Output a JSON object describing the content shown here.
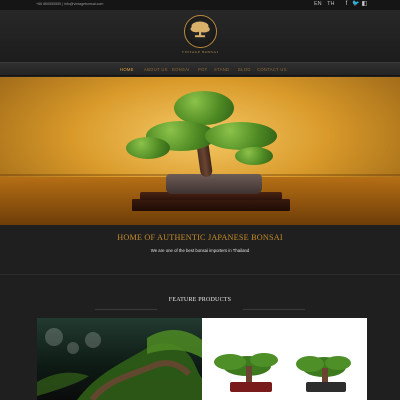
{
  "header": {
    "contact_text": "+66 860555555 | info@vintagebonsai.com",
    "languages": [
      "EN",
      "TH"
    ],
    "social_icons": [
      "facebook-icon",
      "twitter-icon",
      "instagram-icon"
    ],
    "logo_text": "VINTAGE BONSAI"
  },
  "nav": {
    "items": [
      "HOME",
      "ABOUT US",
      "BONSAI",
      "POT",
      "STAND",
      "BLOG",
      "CONTACT US"
    ]
  },
  "hero": {
    "image_subject": "bonsai-tree-on-stand"
  },
  "welcome": {
    "title": "HOME OF AUTHENTIC JAPANESE BONSAI",
    "subtitle": "We are one of the best bonsai importers in Thailand"
  },
  "featured": {
    "title": "FEATURE PRODUCTS"
  },
  "colors": {
    "accent_gold": "#c48b2b",
    "nav_active": "#e0a13c",
    "background": "#1f1f1f"
  }
}
